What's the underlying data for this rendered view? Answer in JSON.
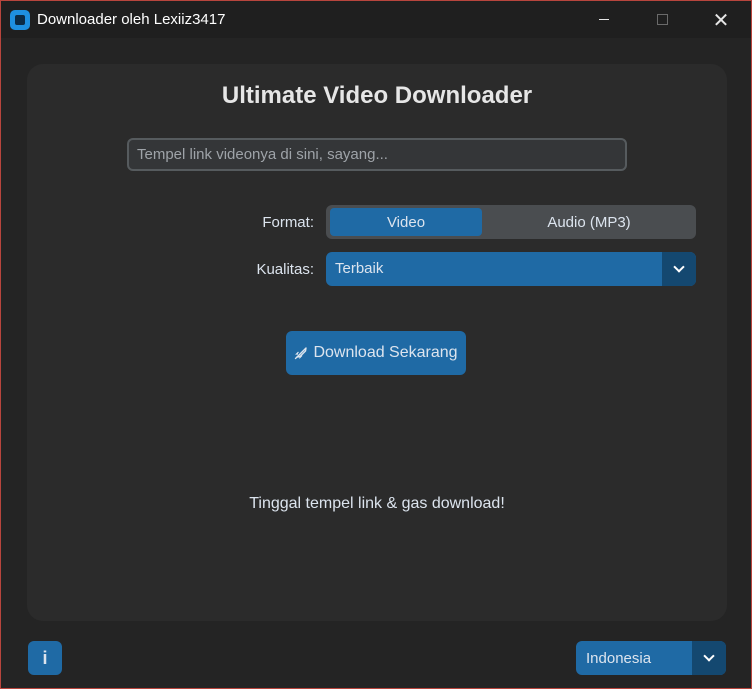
{
  "window": {
    "title": "Downloader oleh Lexiiz3417",
    "controls": {
      "minimize": "",
      "maximize": "",
      "close": "✕"
    }
  },
  "main": {
    "heading": "Ultimate Video Downloader",
    "url_input": {
      "value": "",
      "placeholder": "Tempel link videonya di sini, sayang..."
    },
    "format": {
      "label": "Format:",
      "options": [
        "Video",
        "Audio (MP3)"
      ],
      "selected": "Video"
    },
    "quality": {
      "label": "Kualitas:",
      "selected": "Terbaik"
    },
    "download_button": {
      "icon": "rocket-icon",
      "label": "Download Sekarang"
    },
    "status": "Tinggal tempel link & gas download!"
  },
  "footer": {
    "info_button": "i",
    "language": {
      "selected": "Indonesia"
    }
  },
  "colors": {
    "accent": "#1f6aa5",
    "accent_dark": "#144870",
    "frame": "#2b2b2b",
    "background": "#242424",
    "text": "#dce4ee"
  }
}
